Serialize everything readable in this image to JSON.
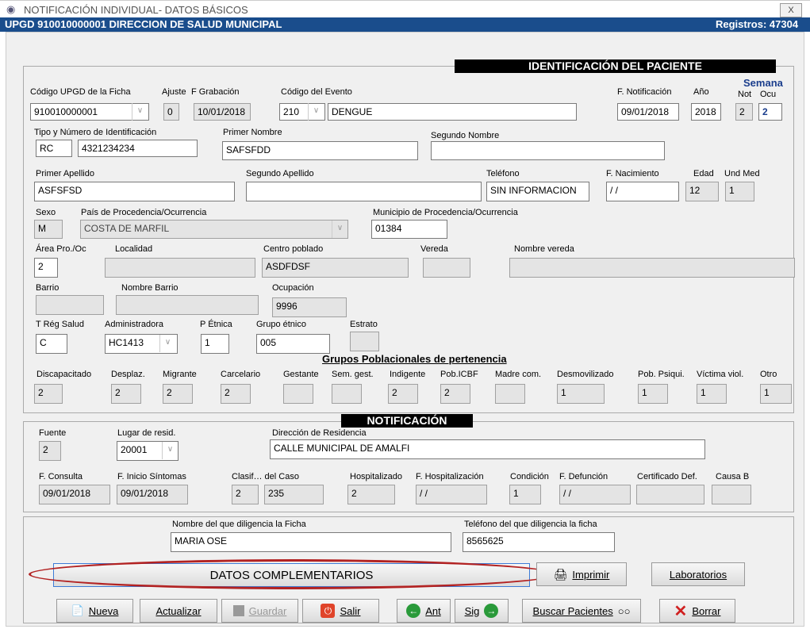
{
  "window": {
    "title": "NOTIFICACIÓN INDIVIDUAL- DATOS BÁSICOS",
    "close": "X"
  },
  "subheader": {
    "left": "UPGD 910010000001 DIRECCION DE SALUD MUNICIPAL",
    "right": "Registros: 47304"
  },
  "sections": {
    "patient": "IDENTIFICACIÓN DEL PACIENTE",
    "notification": "NOTIFICACIÓN",
    "groups": "Grupos Poblacionales de pertenencia"
  },
  "labels": {
    "upgd": "Código UPGD de la Ficha",
    "ajuste": "Ajuste",
    "fgrab": "F Grabación",
    "evento": "Código del Evento",
    "fnotif": "F. Notificación",
    "anio": "Año",
    "semana": "Semana",
    "not": "Not",
    "ocu": "Ocu",
    "tipoid": "Tipo y Número de Identificación",
    "nombre1": "Primer Nombre",
    "nombre2": "Segundo Nombre",
    "apellido1": "Primer Apellido",
    "apellido2": "Segundo Apellido",
    "telefono": "Teléfono",
    "fnac": "F. Nacimiento",
    "edad": "Edad",
    "undmed": "Und Med",
    "sexo": "Sexo",
    "pais": "País de Procedencia/Ocurrencia",
    "municipio": "Municipio de Procedencia/Ocurrencia",
    "area": "Área Pro./Oc",
    "localidad": "Localidad",
    "centro": "Centro poblado",
    "vereda": "Vereda",
    "nvereda": "Nombre vereda",
    "barrio": "Barrio",
    "nbarrio": "Nombre Barrio",
    "ocupacion": "Ocupación",
    "treg": "T Rég Salud",
    "admin": "Administradora",
    "petnica": "P Étnica",
    "grupoetnico": "Grupo étnico",
    "estrato": "Estrato",
    "fuente": "Fuente",
    "lugarres": "Lugar de resid.",
    "direccion": "Dirección de Residencia",
    "fconsulta": "F. Consulta",
    "finicio": "F. Inicio Síntomas",
    "clasif": "Clasif… del Caso",
    "hosp": "Hospitalizado",
    "fhosp": "F. Hospitalización",
    "condicion": "Condición",
    "fdef": "F. Defunción",
    "certdef": "Certificado Def.",
    "causab": "Causa B",
    "nombrediligencia": "Nombre del que diligencia la Ficha",
    "teldiligencia": "Teléfono del que diligencia la ficha"
  },
  "values": {
    "upgd": "910010000001",
    "ajuste": "0",
    "fgrab": "10/01/2018",
    "evento_code": "210",
    "evento_name": "DENGUE",
    "fnotif": "09/01/2018",
    "anio": "2018",
    "not": "2",
    "ocu": "2",
    "tipoid": "RC",
    "numid": "4321234234",
    "nombre1": "SAFSFDD",
    "nombre2": "",
    "apellido1": "ASFSFSD",
    "apellido2": "",
    "telefono": "SIN INFORMACION",
    "fnac": " / /",
    "edad": "12",
    "undmed": "1",
    "sexo": "M",
    "pais": "COSTA DE MARFIL",
    "municipio": "01384",
    "area": "2",
    "localidad": "",
    "centro": "ASDFDSF",
    "vereda": "",
    "nvereda": "",
    "barrio": "",
    "nbarrio": "",
    "ocupacion": "9996",
    "treg": "C",
    "admin": "HC1413",
    "petnica": "1",
    "grupoetnico": "005",
    "estrato": "",
    "fuente": "2",
    "lugarres": "20001",
    "direccion": "CALLE MUNICIPAL DE AMALFI",
    "fconsulta": "09/01/2018",
    "finicio": "09/01/2018",
    "clasif1": "2",
    "clasif2": "235",
    "hosp": "2",
    "fhosp": " / /",
    "condicion": "1",
    "fdef": " / /",
    "certdef": "",
    "causab": "",
    "nombrediligencia": "MARIA OSE",
    "teldiligencia": "8565625"
  },
  "groups": [
    {
      "label": "Discapacitado",
      "value": "2"
    },
    {
      "label": "Desplaz.",
      "value": "2"
    },
    {
      "label": "Migrante",
      "value": "2"
    },
    {
      "label": "Carcelario",
      "value": "2"
    },
    {
      "label": "Gestante",
      "value": ""
    },
    {
      "label": "Sem. gest.",
      "value": ""
    },
    {
      "label": "Indigente",
      "value": "2"
    },
    {
      "label": "Pob.ICBF",
      "value": "2"
    },
    {
      "label": "Madre com.",
      "value": ""
    },
    {
      "label": "Desmovilizado",
      "value": "1"
    },
    {
      "label": "Pob. Psiqui.",
      "value": "1"
    },
    {
      "label": "Víctima viol.",
      "value": "1"
    },
    {
      "label": "Otro",
      "value": "1"
    }
  ],
  "buttons": {
    "complementarios": "DATOS COMPLEMENTARIOS",
    "imprimir": "Imprimir",
    "laboratorios": "Laboratorios",
    "nueva": "Nueva",
    "actualizar": "Actualizar",
    "guardar": "Guardar",
    "salir": "Salir",
    "ant": "Ant",
    "sig": "Sig",
    "buscar": "Buscar Pacientes",
    "borrar": "Borrar"
  },
  "colors": {
    "header_bar": "#1a4d8c",
    "highlight_ring": "#b22222"
  }
}
